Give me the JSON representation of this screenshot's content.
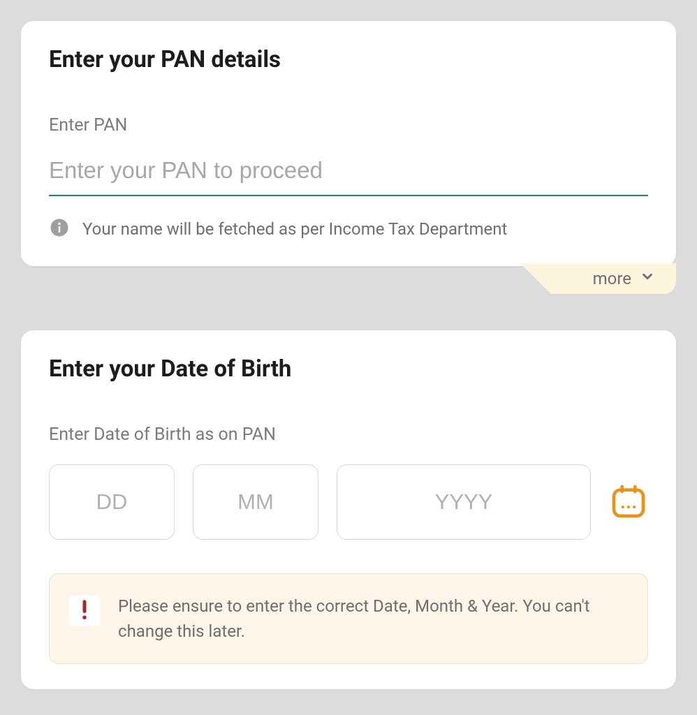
{
  "pan_section": {
    "title": "Enter your PAN details",
    "field_label": "Enter PAN",
    "input_placeholder": "Enter your PAN to proceed",
    "info_text": "Your name will be fetched as per Income Tax Department",
    "more_label": "more"
  },
  "dob_section": {
    "title": "Enter your Date of Birth",
    "field_label": "Enter Date of Birth as on PAN",
    "dd_placeholder": "DD",
    "mm_placeholder": "MM",
    "yyyy_placeholder": "YYYY",
    "warning_text": "Please ensure to enter the correct Date, Month & Year. You can't change this later."
  }
}
